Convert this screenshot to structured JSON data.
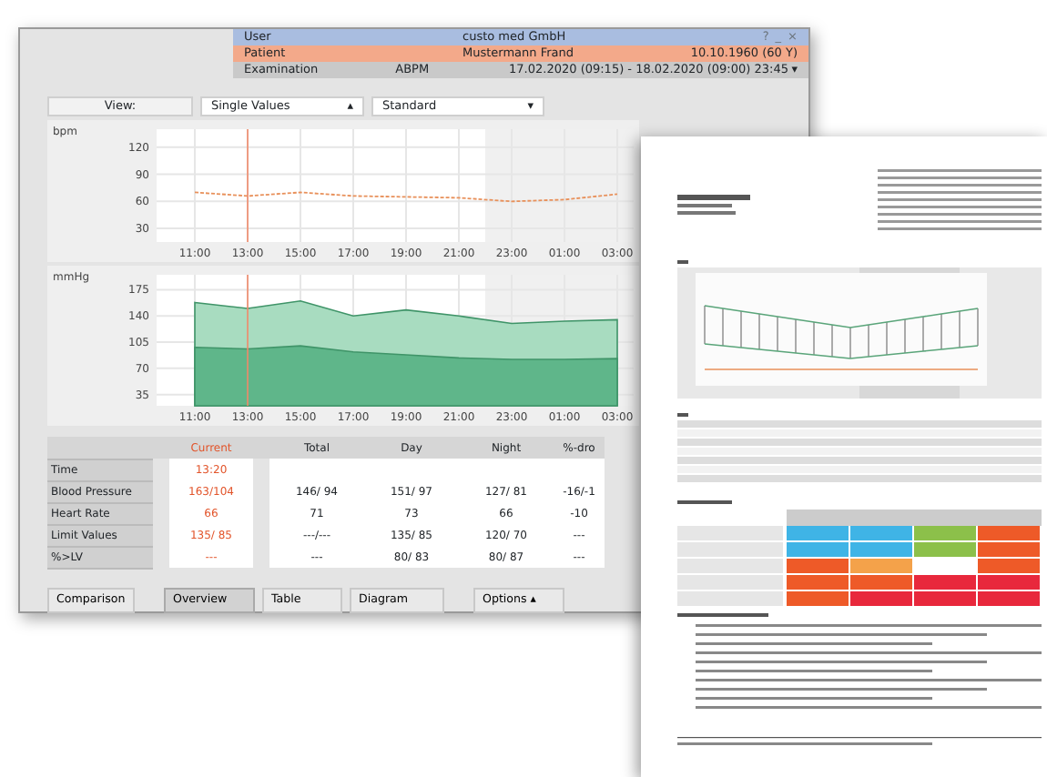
{
  "header": {
    "rows": [
      {
        "kind": "user",
        "label": "User",
        "value": "custo med GmbH",
        "extra": ""
      },
      {
        "kind": "patient",
        "label": "Patient",
        "value": "Mustermann Frand",
        "extra": "10.10.1960 (60 Y)"
      },
      {
        "kind": "exam",
        "label": "Examination",
        "value": "ABPM",
        "extra": "17.02.2020 (09:15) - 18.02.2020 (09:00)  23:45",
        "caret": "▾"
      }
    ],
    "window_controls": [
      "?",
      "_",
      "×"
    ]
  },
  "toolbar": {
    "view_label": "View:",
    "mode": "Single Values",
    "mode_caret": "▴",
    "preset": "Standard",
    "preset_caret": "▾"
  },
  "heart_chart": {
    "unit": "bpm",
    "chart_data": {
      "type": "line",
      "categories": [
        "11:00",
        "13:00",
        "15:00",
        "17:00",
        "19:00",
        "21:00",
        "23:00",
        "01:00",
        "03:00"
      ],
      "series": [
        {
          "color": "#e8905a",
          "values": [
            70,
            66,
            70,
            66,
            65,
            64,
            60,
            62,
            68
          ]
        }
      ],
      "line_style": "dashed",
      "grid": true,
      "ylim": [
        15,
        140
      ],
      "yticks": [
        30,
        60,
        90,
        120
      ],
      "ref_lines": [
        {
          "axis": "x",
          "value": "13:00",
          "color": "#f08a6a"
        }
      ]
    }
  },
  "bp_chart": {
    "unit": "mmHg",
    "chart_data": {
      "type": "area",
      "categories": [
        "11:00",
        "13:00",
        "15:00",
        "17:00",
        "19:00",
        "21:00",
        "23:00",
        "01:00",
        "03:00"
      ],
      "series": [
        {
          "color": "#a8dcc0",
          "values": [
            158,
            150,
            160,
            140,
            148,
            140,
            130,
            133,
            135
          ]
        },
        {
          "color": "#5fb68a",
          "values": [
            98,
            96,
            100,
            92,
            88,
            84,
            82,
            82,
            83
          ]
        }
      ],
      "grid": true,
      "ylim": [
        20,
        195
      ],
      "yticks": [
        35,
        70,
        105,
        140,
        175
      ],
      "ref_lines": [
        {
          "axis": "x",
          "value": "13:00",
          "color": "#f08a6a"
        }
      ]
    }
  },
  "summary_table": {
    "columns": [
      "Current",
      "Total",
      "Day",
      "Night",
      "%-dro"
    ],
    "rows": [
      {
        "label": "Time",
        "cells": [
          "13:20",
          "",
          "",
          "",
          ""
        ]
      },
      {
        "label": "Blood Pressure",
        "cells": [
          "163/104",
          "146/ 94",
          "151/ 97",
          "127/ 81",
          "-16/-1"
        ]
      },
      {
        "label": "Heart Rate",
        "cells": [
          "66",
          "71",
          "73",
          "66",
          "-10"
        ]
      },
      {
        "label": "Limit Values",
        "cells": [
          "135/ 85",
          "---/---",
          "135/ 85",
          "120/ 70",
          "---"
        ]
      },
      {
        "label": "%>LV",
        "cells": [
          "---",
          "---",
          "80/ 83",
          "80/ 87",
          "---"
        ]
      }
    ]
  },
  "buttons": [
    {
      "label": "Comparison",
      "selected": false
    },
    {
      "label": "Overview",
      "selected": true
    },
    {
      "label": "Table",
      "selected": false
    },
    {
      "label": "Diagram",
      "selected": false
    },
    {
      "label": "Options ▴",
      "selected": false
    }
  ]
}
